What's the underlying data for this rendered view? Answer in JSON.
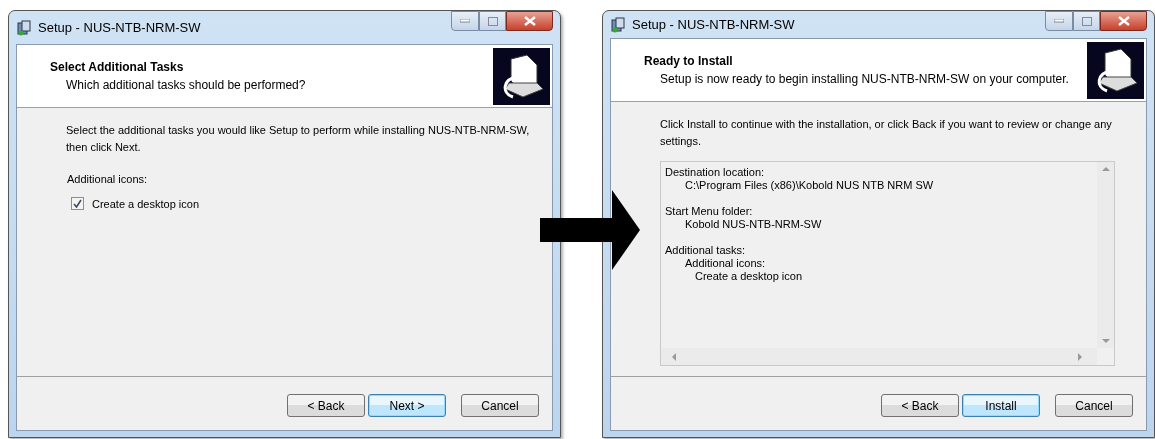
{
  "windows": [
    {
      "title": "Setup - NUS-NTB-NRM-SW",
      "heading": "Select Additional Tasks",
      "subheading": "Which additional tasks should be performed?",
      "instructions": "Select the additional tasks you would like Setup to perform while installing NUS-NTB-NRM-SW, then click Next.",
      "content": {
        "kind": "tasks",
        "group_label": "Additional icons:",
        "options": [
          {
            "label": "Create a desktop icon",
            "checked": true
          }
        ]
      },
      "buttons": [
        {
          "label": "< Back",
          "default": false
        },
        {
          "label": "Next >",
          "default": true
        },
        {
          "label": "Cancel",
          "default": false
        }
      ]
    },
    {
      "title": "Setup - NUS-NTB-NRM-SW",
      "heading": "Ready to Install",
      "subheading": "Setup is now ready to begin installing NUS-NTB-NRM-SW on your computer.",
      "instructions": "Click Install to continue with the installation, or click Back if you want to review or change any settings.",
      "content": {
        "kind": "summary",
        "items": [
          {
            "text": "Destination location:",
            "children": [
              {
                "text": "C:\\Program Files (x86)\\Kobold NUS NTB NRM SW"
              }
            ]
          },
          {
            "text": "Start Menu folder:",
            "children": [
              {
                "text": "Kobold NUS-NTB-NRM-SW"
              }
            ]
          },
          {
            "text": "Additional tasks:",
            "children": [
              {
                "text": "Additional icons:",
                "children": [
                  {
                    "text": "Create a desktop icon"
                  }
                ]
              }
            ]
          }
        ]
      },
      "buttons": [
        {
          "label": "< Back",
          "default": false
        },
        {
          "label": "Install",
          "default": true
        },
        {
          "label": "Cancel",
          "default": false
        }
      ]
    }
  ]
}
